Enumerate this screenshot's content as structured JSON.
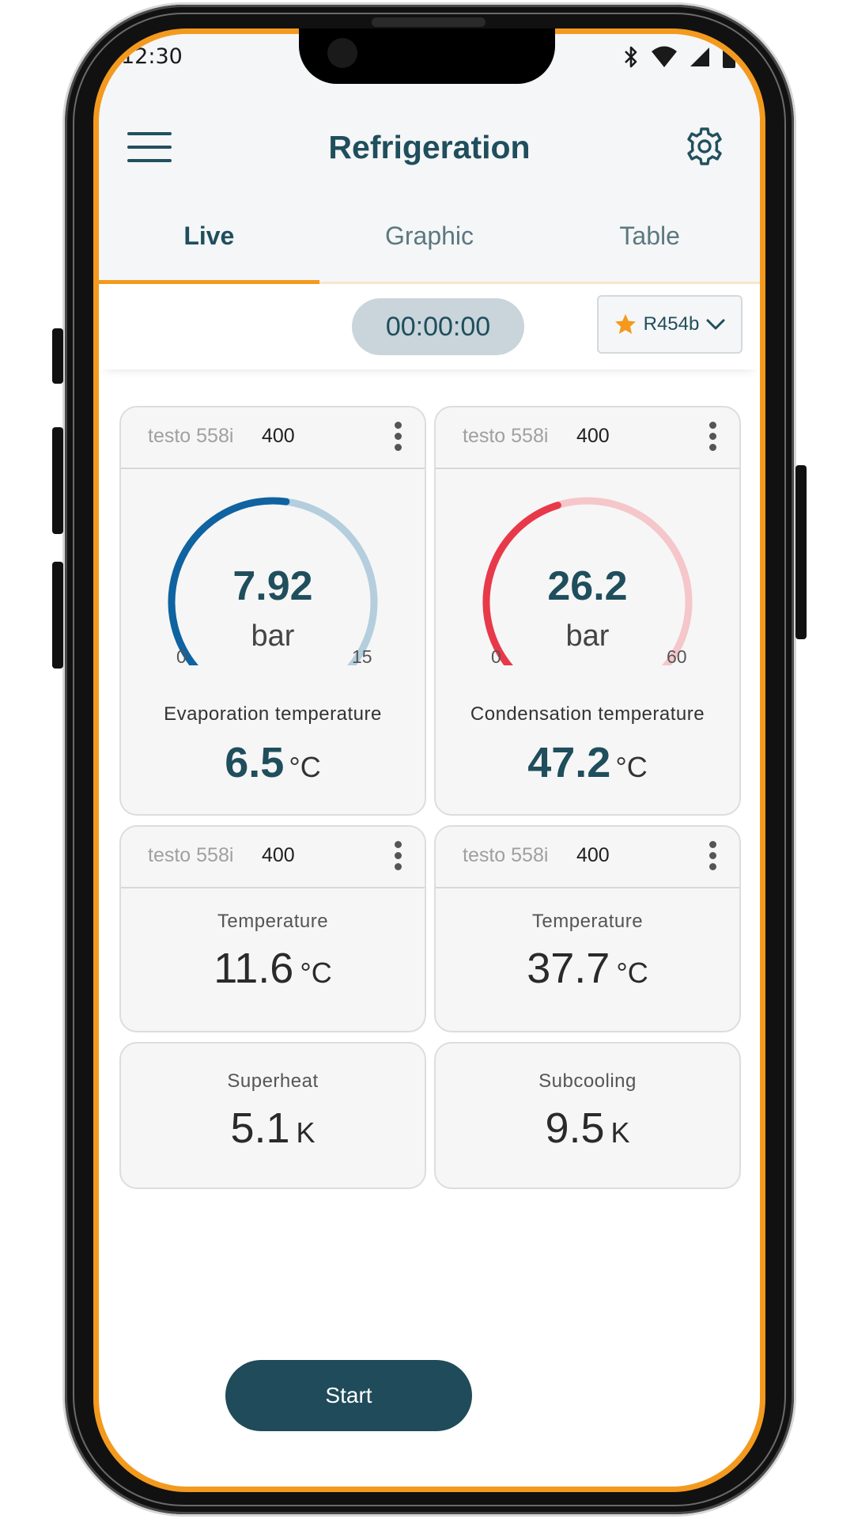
{
  "status_bar": {
    "time": "12:30"
  },
  "header": {
    "title": "Refrigeration"
  },
  "tabs": [
    {
      "label": "Live",
      "active": true
    },
    {
      "label": "Graphic",
      "active": false
    },
    {
      "label": "Table",
      "active": false
    }
  ],
  "timer": {
    "value": "00:00:00"
  },
  "refrigerant": {
    "label": "R454b",
    "favorite": true
  },
  "cards": [
    {
      "probe": "testo 558i",
      "probe_id": "400",
      "gauge": {
        "value": 7.92,
        "value_text": "7.92",
        "unit": "bar",
        "min": 0,
        "max": 15,
        "min_text": "0",
        "max_text": "15",
        "color": "#0F63A0",
        "track_color": "#B4CEDD"
      },
      "saturation": {
        "label": "Evaporation temperature",
        "value": "6.5",
        "unit": "°C"
      }
    },
    {
      "probe": "testo 558i",
      "probe_id": "400",
      "gauge": {
        "value": 26.2,
        "value_text": "26.2",
        "unit": "bar",
        "min": 0,
        "max": 60,
        "min_text": "0",
        "max_text": "60",
        "color": "#E8394A",
        "track_color": "#F5C6CA"
      },
      "saturation": {
        "label": "Condensation temperature",
        "value": "47.2",
        "unit": "°C"
      }
    },
    {
      "probe": "testo 558i",
      "probe_id": "400",
      "label": "Temperature",
      "value": "11.6",
      "unit": "°C"
    },
    {
      "probe": "testo 558i",
      "probe_id": "400",
      "label": "Temperature",
      "value": "37.7",
      "unit": "°C"
    }
  ],
  "calculated": [
    {
      "label": "Superheat",
      "value": "5.1",
      "unit": "K"
    },
    {
      "label": "Subcooling",
      "value": "9.5",
      "unit": "K"
    }
  ],
  "actions": {
    "start_label": "Start"
  },
  "colors": {
    "accent": "#F39A1E",
    "primary": "#1F4E5C",
    "button": "#1F4B5A"
  }
}
